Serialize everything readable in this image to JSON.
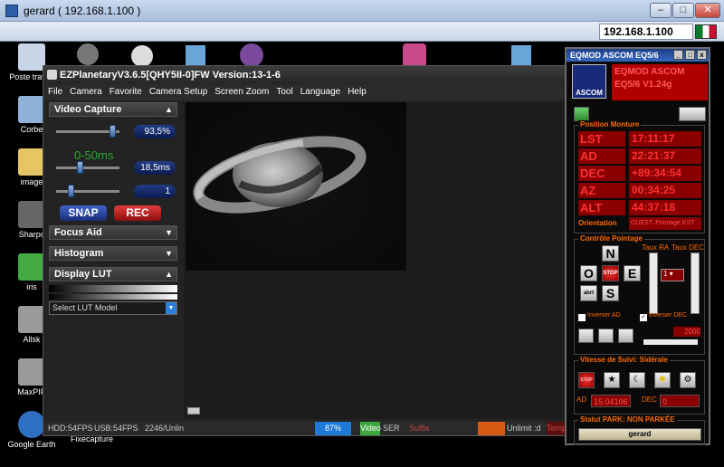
{
  "remote": {
    "title": "gerard ( 192.168.1.100 )",
    "ip_value": "192.168.1.100",
    "buttons": {
      "minimize": "–",
      "maximize": "□",
      "close": "✕"
    },
    "toolbar_icons": [
      "connect-icon",
      "keyboard-icon",
      "tools-icon",
      "refresh-icon",
      "windows-icon",
      "drive-icon",
      "alert-icon",
      "speed-icon",
      "fullscreen-icon",
      "screen-icon",
      "transfer-icon",
      "chat-icon",
      "record-icon",
      "camera-icon",
      "settings-icon"
    ]
  },
  "desktop": {
    "icons": [
      {
        "label": "Poste travail",
        "color": "#c9d6e8"
      },
      {
        "label": "Corbe",
        "color": "#8fb0d9"
      },
      {
        "label": "image",
        "color": "#e6c564"
      },
      {
        "label": "Sharpc",
        "color": "#666666"
      },
      {
        "label": "iris",
        "color": "#44aa44"
      },
      {
        "label": "Allsk",
        "color": "#9a9a9a"
      },
      {
        "label": "MaxPIP",
        "color": "#9a9a9a"
      },
      {
        "label": "Google Earth",
        "color": "#2f6fc2"
      }
    ],
    "taskbar_text": "Fixecapture"
  },
  "ez": {
    "title": "EZPlanetaryV3.6.5[QHY5II-0]FW Version:13-1-6",
    "menu": [
      "File",
      "Camera",
      "Favorite",
      "Camera Setup",
      "Screen Zoom",
      "Tool",
      "Language",
      "Help"
    ],
    "video_capture": {
      "header": "Video Capture",
      "gain": "93,5%",
      "exposure_label": "0-50ms",
      "exposure": "18,5ms",
      "binning": "1",
      "gain_level": 0.93,
      "exposure_level": 0.37,
      "binning_level": 0.2,
      "snap": "SNAP",
      "rec": "REC"
    },
    "focus_aid": "Focus Aid",
    "histogram": "Histogram",
    "display_lut": "Display LUT",
    "lut_select": "Select LUT Model",
    "status": {
      "hdd": "HDD:54FPS",
      "usb": "USB:54FPS",
      "frames": "2246/Unlin",
      "progress": "87%",
      "video": "Video",
      "ser": "SER",
      "suffix": "Suffix",
      "unlimit": "Unlimit :d",
      "temp": "Temp"
    }
  },
  "eq": {
    "title": "EQMOD ASCOM EQ5/6",
    "version_line1": "EQMOD ASCOM",
    "version_line2": "EQ5/6 V1.24g",
    "ascom_logo": "ASCOM",
    "position_header": "Position Monture",
    "positions": [
      {
        "label": "LST",
        "value": "17:11:17"
      },
      {
        "label": "AD",
        "value": "22:21:37"
      },
      {
        "label": "DEC",
        "value": "+89:34:54"
      },
      {
        "label": "AZ",
        "value": "00:34:25"
      },
      {
        "label": "ALT",
        "value": "44:37:18"
      }
    ],
    "orientation_label": "Orientation",
    "orientation_value": "OUEST, Pointage EST",
    "pointing_header": "Contrôle Pointage",
    "taux_ra": "Taux RA",
    "taux_dec": "Taux DEC",
    "pad": {
      "n": "N",
      "s": "S",
      "e": "E",
      "o": "O",
      "stop": "STOP",
      "abort": "abrt"
    },
    "rate_value": "1",
    "inverser_ad": "Inverser AD",
    "inverser_dec": "Inverser DEC",
    "inverser_dec_checked": true,
    "slider_value": "2000",
    "tracking_header": "Vitesse de Suivi: Sidérale",
    "ad_label": "AD",
    "ad_value": "15.04106",
    "dec_label": "DEC",
    "dec_value": "0",
    "park_header": "Statut PARK: NON PARKÉE",
    "park_button": "gerard"
  }
}
